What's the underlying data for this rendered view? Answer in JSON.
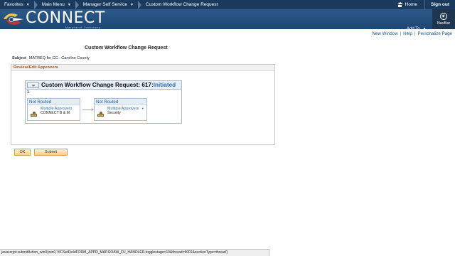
{
  "top_nav": {
    "favorites": "Favorites",
    "main_menu": "Main Menu",
    "manager_self_service": "Manager Self Service",
    "current_page": "Custom Workflow Change Request",
    "home": "Home",
    "sign_out": "Sign out"
  },
  "brand": {
    "logo_text": "CONNECT",
    "logo_subtitle": "Maryland Judiciary",
    "add_to": "Add To",
    "navbar": "NavBar"
  },
  "util_links": {
    "new_window": "New Window",
    "help": "Help",
    "personalize": "Personalize Page",
    "separator": "|"
  },
  "page": {
    "title": "Custom Workflow Change Request",
    "subject_label": "Subject",
    "subject_value": "MATREQ for CC - Caroline County"
  },
  "panel": {
    "header": "Review/Edit Approvers",
    "workflow_title": "Custom Workflow Change Request: 617:",
    "workflow_status": "Initiated",
    "stage_number": "1",
    "stages": [
      {
        "status": "Not Routed",
        "link": "Multiple Approvers",
        "approver": "CONNECT B & M"
      },
      {
        "status": "Not Routed",
        "link": "Multiple Approvers",
        "approver": "Security"
      }
    ]
  },
  "buttons": {
    "ok": "OK",
    "submit": "Submit"
  },
  "status_bar": "javascript:submitAction_win0(win0,'#ICSetFieldFORM_APPR_MAP.EOAW_FU_HANDLER.togglestage=10&thread=5001&sectionType=thread')",
  "colors": {
    "top_nav": "#1a3a5e",
    "brand_bar": "#2b5a8a",
    "link": "#1b4f8c",
    "panel_header_text": "#b05a1a",
    "workflow_status": "#2f6db5",
    "button": "#f5cf8a"
  }
}
